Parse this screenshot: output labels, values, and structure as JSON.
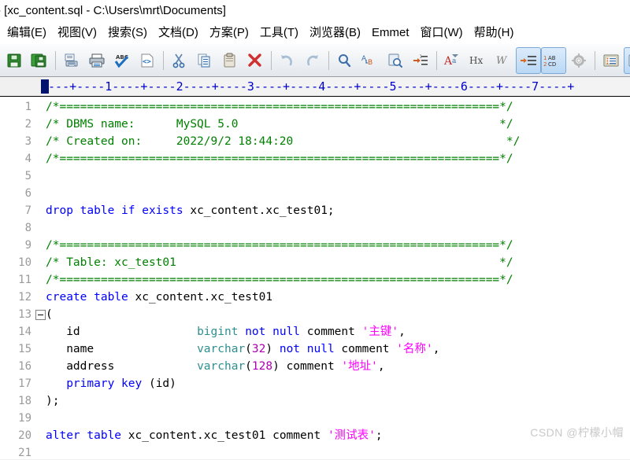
{
  "window": {
    "title": "- [xc_content.sql - C:\\Users\\mrt\\Documents]"
  },
  "menubar": {
    "items": [
      {
        "label": "编辑(E)",
        "name": "menu-edit"
      },
      {
        "label": "视图(V)",
        "name": "menu-view"
      },
      {
        "label": "搜索(S)",
        "name": "menu-search"
      },
      {
        "label": "文档(D)",
        "name": "menu-document"
      },
      {
        "label": "方案(P)",
        "name": "menu-project"
      },
      {
        "label": "工具(T)",
        "name": "menu-tools"
      },
      {
        "label": "浏览器(B)",
        "name": "menu-browser"
      },
      {
        "label": "Emmet",
        "name": "menu-emmet"
      },
      {
        "label": "窗口(W)",
        "name": "menu-window"
      },
      {
        "label": "帮助(H)",
        "name": "menu-help"
      }
    ]
  },
  "toolbar": {
    "buttons": [
      {
        "icon": "save-icon",
        "active": false
      },
      {
        "icon": "save-all-icon",
        "active": false
      },
      {
        "sep": true
      },
      {
        "icon": "print-preview-icon",
        "active": false
      },
      {
        "icon": "print-icon",
        "active": false
      },
      {
        "icon": "spellcheck-icon",
        "active": false
      },
      {
        "icon": "view-source-icon",
        "active": false
      },
      {
        "sep": true
      },
      {
        "icon": "cut-icon",
        "active": false
      },
      {
        "icon": "copy-icon",
        "active": false
      },
      {
        "icon": "paste-icon",
        "active": false
      },
      {
        "icon": "delete-icon",
        "active": false
      },
      {
        "sep": true
      },
      {
        "icon": "undo-icon",
        "active": false
      },
      {
        "icon": "redo-icon",
        "active": false
      },
      {
        "sep": true
      },
      {
        "icon": "find-icon",
        "active": false
      },
      {
        "icon": "replace-icon",
        "active": false
      },
      {
        "icon": "find-in-files-icon",
        "active": false
      },
      {
        "icon": "goto-line-icon",
        "active": false
      },
      {
        "sep": true
      },
      {
        "icon": "font-icon",
        "active": false
      },
      {
        "icon": "hex-view-icon",
        "active": false
      },
      {
        "icon": "word-wrap-icon",
        "active": false
      },
      {
        "icon": "show-indent-guide-icon",
        "active": true
      },
      {
        "icon": "show-all-chars-icon",
        "active": true
      },
      {
        "icon": "settings-icon",
        "active": false
      },
      {
        "sep": true
      },
      {
        "icon": "file-explorer-icon",
        "active": false
      },
      {
        "icon": "document-map-icon",
        "active": true
      }
    ]
  },
  "ruler": {
    "text": "----+----1----+----2----+----3----+----4----+----5----+----6----+----7----+"
  },
  "editor": {
    "current_line": 1,
    "fold_line": 13,
    "lines": [
      {
        "n": 1,
        "tokens": [
          {
            "t": "/*================================================================*/",
            "c": "cmt"
          }
        ]
      },
      {
        "n": 2,
        "tokens": [
          {
            "t": "/* DBMS name:      MySQL 5.0                                      */",
            "c": "cmt"
          }
        ]
      },
      {
        "n": 3,
        "tokens": [
          {
            "t": "/* Created on:     2022/9/2 18:44:20                               */",
            "c": "cmt"
          }
        ]
      },
      {
        "n": 4,
        "tokens": [
          {
            "t": "/*================================================================*/",
            "c": "cmt"
          }
        ]
      },
      {
        "n": 5,
        "tokens": []
      },
      {
        "n": 6,
        "tokens": []
      },
      {
        "n": 7,
        "tokens": [
          {
            "t": "drop table if exists",
            "c": "kw"
          },
          {
            "t": " xc_content.xc_test01;",
            "c": "pln"
          }
        ]
      },
      {
        "n": 8,
        "tokens": []
      },
      {
        "n": 9,
        "tokens": [
          {
            "t": "/*================================================================*/",
            "c": "cmt"
          }
        ]
      },
      {
        "n": 10,
        "tokens": [
          {
            "t": "/* Table: xc_test01                                               */",
            "c": "cmt"
          }
        ]
      },
      {
        "n": 11,
        "tokens": [
          {
            "t": "/*================================================================*/",
            "c": "cmt"
          }
        ]
      },
      {
        "n": 12,
        "tokens": [
          {
            "t": "create table",
            "c": "kw"
          },
          {
            "t": " xc_content.xc_test01",
            "c": "pln"
          }
        ]
      },
      {
        "n": 13,
        "tokens": [
          {
            "t": "(",
            "c": "pln"
          }
        ]
      },
      {
        "n": 14,
        "tokens": [
          {
            "t": "   id                 ",
            "c": "pln"
          },
          {
            "t": "bigint",
            "c": "typ"
          },
          {
            "t": " ",
            "c": "pln"
          },
          {
            "t": "not null",
            "c": "kw"
          },
          {
            "t": " comment ",
            "c": "pln"
          },
          {
            "t": "'主键'",
            "c": "str"
          },
          {
            "t": ",",
            "c": "pln"
          }
        ]
      },
      {
        "n": 15,
        "tokens": [
          {
            "t": "   name               ",
            "c": "pln"
          },
          {
            "t": "varchar",
            "c": "typ"
          },
          {
            "t": "(",
            "c": "pln"
          },
          {
            "t": "32",
            "c": "num"
          },
          {
            "t": ") ",
            "c": "pln"
          },
          {
            "t": "not null",
            "c": "kw"
          },
          {
            "t": " comment ",
            "c": "pln"
          },
          {
            "t": "'名称'",
            "c": "str"
          },
          {
            "t": ",",
            "c": "pln"
          }
        ]
      },
      {
        "n": 16,
        "tokens": [
          {
            "t": "   address            ",
            "c": "pln"
          },
          {
            "t": "varchar",
            "c": "typ"
          },
          {
            "t": "(",
            "c": "pln"
          },
          {
            "t": "128",
            "c": "num"
          },
          {
            "t": ") comment ",
            "c": "pln"
          },
          {
            "t": "'地址'",
            "c": "str"
          },
          {
            "t": ",",
            "c": "pln"
          }
        ]
      },
      {
        "n": 17,
        "tokens": [
          {
            "t": "   ",
            "c": "pln"
          },
          {
            "t": "primary key",
            "c": "kw"
          },
          {
            "t": " (id)",
            "c": "pln"
          }
        ]
      },
      {
        "n": 18,
        "tokens": [
          {
            "t": ");",
            "c": "pln"
          }
        ]
      },
      {
        "n": 19,
        "tokens": []
      },
      {
        "n": 20,
        "tokens": [
          {
            "t": "alter table",
            "c": "kw"
          },
          {
            "t": " xc_content.xc_test01 comment ",
            "c": "pln"
          },
          {
            "t": "'测试表'",
            "c": "str"
          },
          {
            "t": ";",
            "c": "pln"
          }
        ]
      },
      {
        "n": 21,
        "tokens": []
      }
    ]
  },
  "watermark": {
    "text": "CSDN @柠檬小帽"
  },
  "colors": {
    "comment": "#008000",
    "keyword": "#0000ff",
    "type": "#2d8f8f",
    "number": "#b000b0",
    "string": "#ff00ff",
    "plain": "#000000",
    "ruler": "#0000cc",
    "linenumber": "#9a9a9a"
  }
}
